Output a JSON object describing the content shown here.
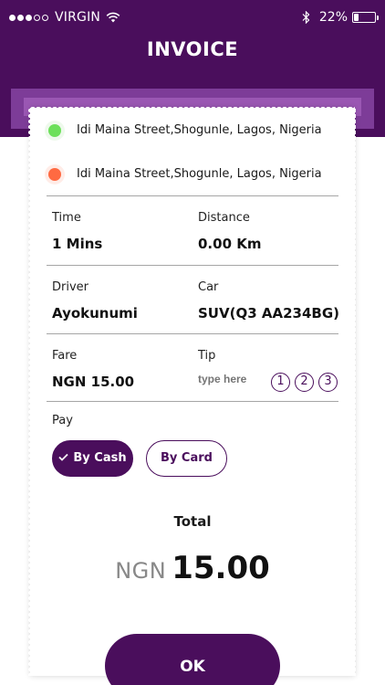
{
  "status_bar": {
    "carrier": "VIRGIN",
    "battery_percent": "22%",
    "battery_level": 0.22,
    "signal_bars_filled": 3,
    "signal_bars_total": 5
  },
  "header": {
    "title": "INVOICE"
  },
  "locations": [
    {
      "address": "Idi Maina Street,Shogunle, Lagos, Nigeria",
      "color": "#6ce05a"
    },
    {
      "address": "Idi Maina Street,Shogunle, Lagos, Nigeria",
      "color": "#ff6a42"
    }
  ],
  "details": {
    "time_label": "Time",
    "time_value": "1 Mins",
    "distance_label": "Distance",
    "distance_value": "0.00 Km",
    "driver_label": "Driver",
    "driver_value": "Ayokunumi",
    "car_label": "Car",
    "car_value": "SUV(Q3 AA234BG)",
    "fare_label": "Fare",
    "fare_value": "NGN 15.00",
    "tip_label": "Tip",
    "tip_placeholder": "type here",
    "tip_options": [
      "1",
      "2",
      "3"
    ]
  },
  "pay": {
    "label": "Pay",
    "cash_label": "By Cash",
    "card_label": "By Card",
    "selected": "cash"
  },
  "total": {
    "label": "Total",
    "currency": "NGN",
    "amount": "15.00"
  },
  "ok_label": "OK",
  "colors": {
    "primary": "#4a0e5c",
    "slot_outer": "#7d3c98",
    "slot_inner": "#9a57b3"
  }
}
